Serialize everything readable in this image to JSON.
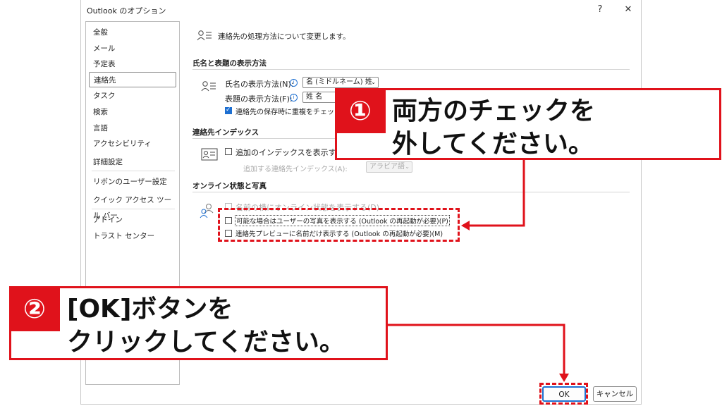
{
  "window": {
    "title": "Outlook のオプション",
    "help": "?",
    "close": "✕"
  },
  "sidebar": {
    "items": [
      {
        "label": "全般"
      },
      {
        "label": "メール"
      },
      {
        "label": "予定表"
      },
      {
        "label": "連絡先"
      },
      {
        "label": "タスク"
      },
      {
        "label": "検索"
      },
      {
        "label": "言語"
      },
      {
        "label": "アクセシビリティ"
      },
      {
        "label": "詳細設定"
      },
      {
        "label": "リボンのユーザー設定"
      },
      {
        "label": "クイック アクセス ツール バー"
      },
      {
        "label": "アドイン"
      },
      {
        "label": "トラスト センター"
      }
    ],
    "selected": "連絡先"
  },
  "header": {
    "text": "連絡先の処理方法について変更します。"
  },
  "names_section": {
    "title": "氏名と表題の表示方法",
    "name_order_label": "氏名の表示方法(N):",
    "name_order_value": "名 (ミドルネーム) 姓",
    "file_as_label": "表題の表示方法(F):",
    "file_as_value": "姓 名",
    "dup_check_label": "連絡先の保存時に重複をチェックする",
    "dup_check_checked": true
  },
  "index_section": {
    "title": "連絡先インデックス",
    "show_index_label": "追加のインデックスを表示する(W)",
    "show_index_checked": false,
    "index_lang_label": "追加する連絡先インデックス(A):",
    "index_lang_value": "アラビア語"
  },
  "online_section": {
    "title": "オンライン状態と写真",
    "show_status_label": "名前の横にオンライン状態を表示する(D)",
    "show_photo_label": "可能な場合はユーザーの写真を表示する (Outlook の再起動が必要)(P)",
    "show_photo_checked": false,
    "first_name_label": "連絡先プレビューに名前だけ表示する (Outlook の再起動が必要)(M)",
    "first_name_checked": false
  },
  "footer": {
    "ok": "OK",
    "cancel": "キャンセル"
  },
  "annotations": {
    "step1": {
      "num": "①",
      "line1": "両方のチェックを",
      "line2": "外してください。"
    },
    "step2": {
      "num": "②",
      "line1": "[OK]ボタンを",
      "line2": "クリックしてください。"
    },
    "color": "#e0121b"
  },
  "icons": [
    "help-icon",
    "close-icon",
    "contact-card-icon",
    "info-icon",
    "chevron-down-icon",
    "people-icon",
    "address-card-icon"
  ]
}
